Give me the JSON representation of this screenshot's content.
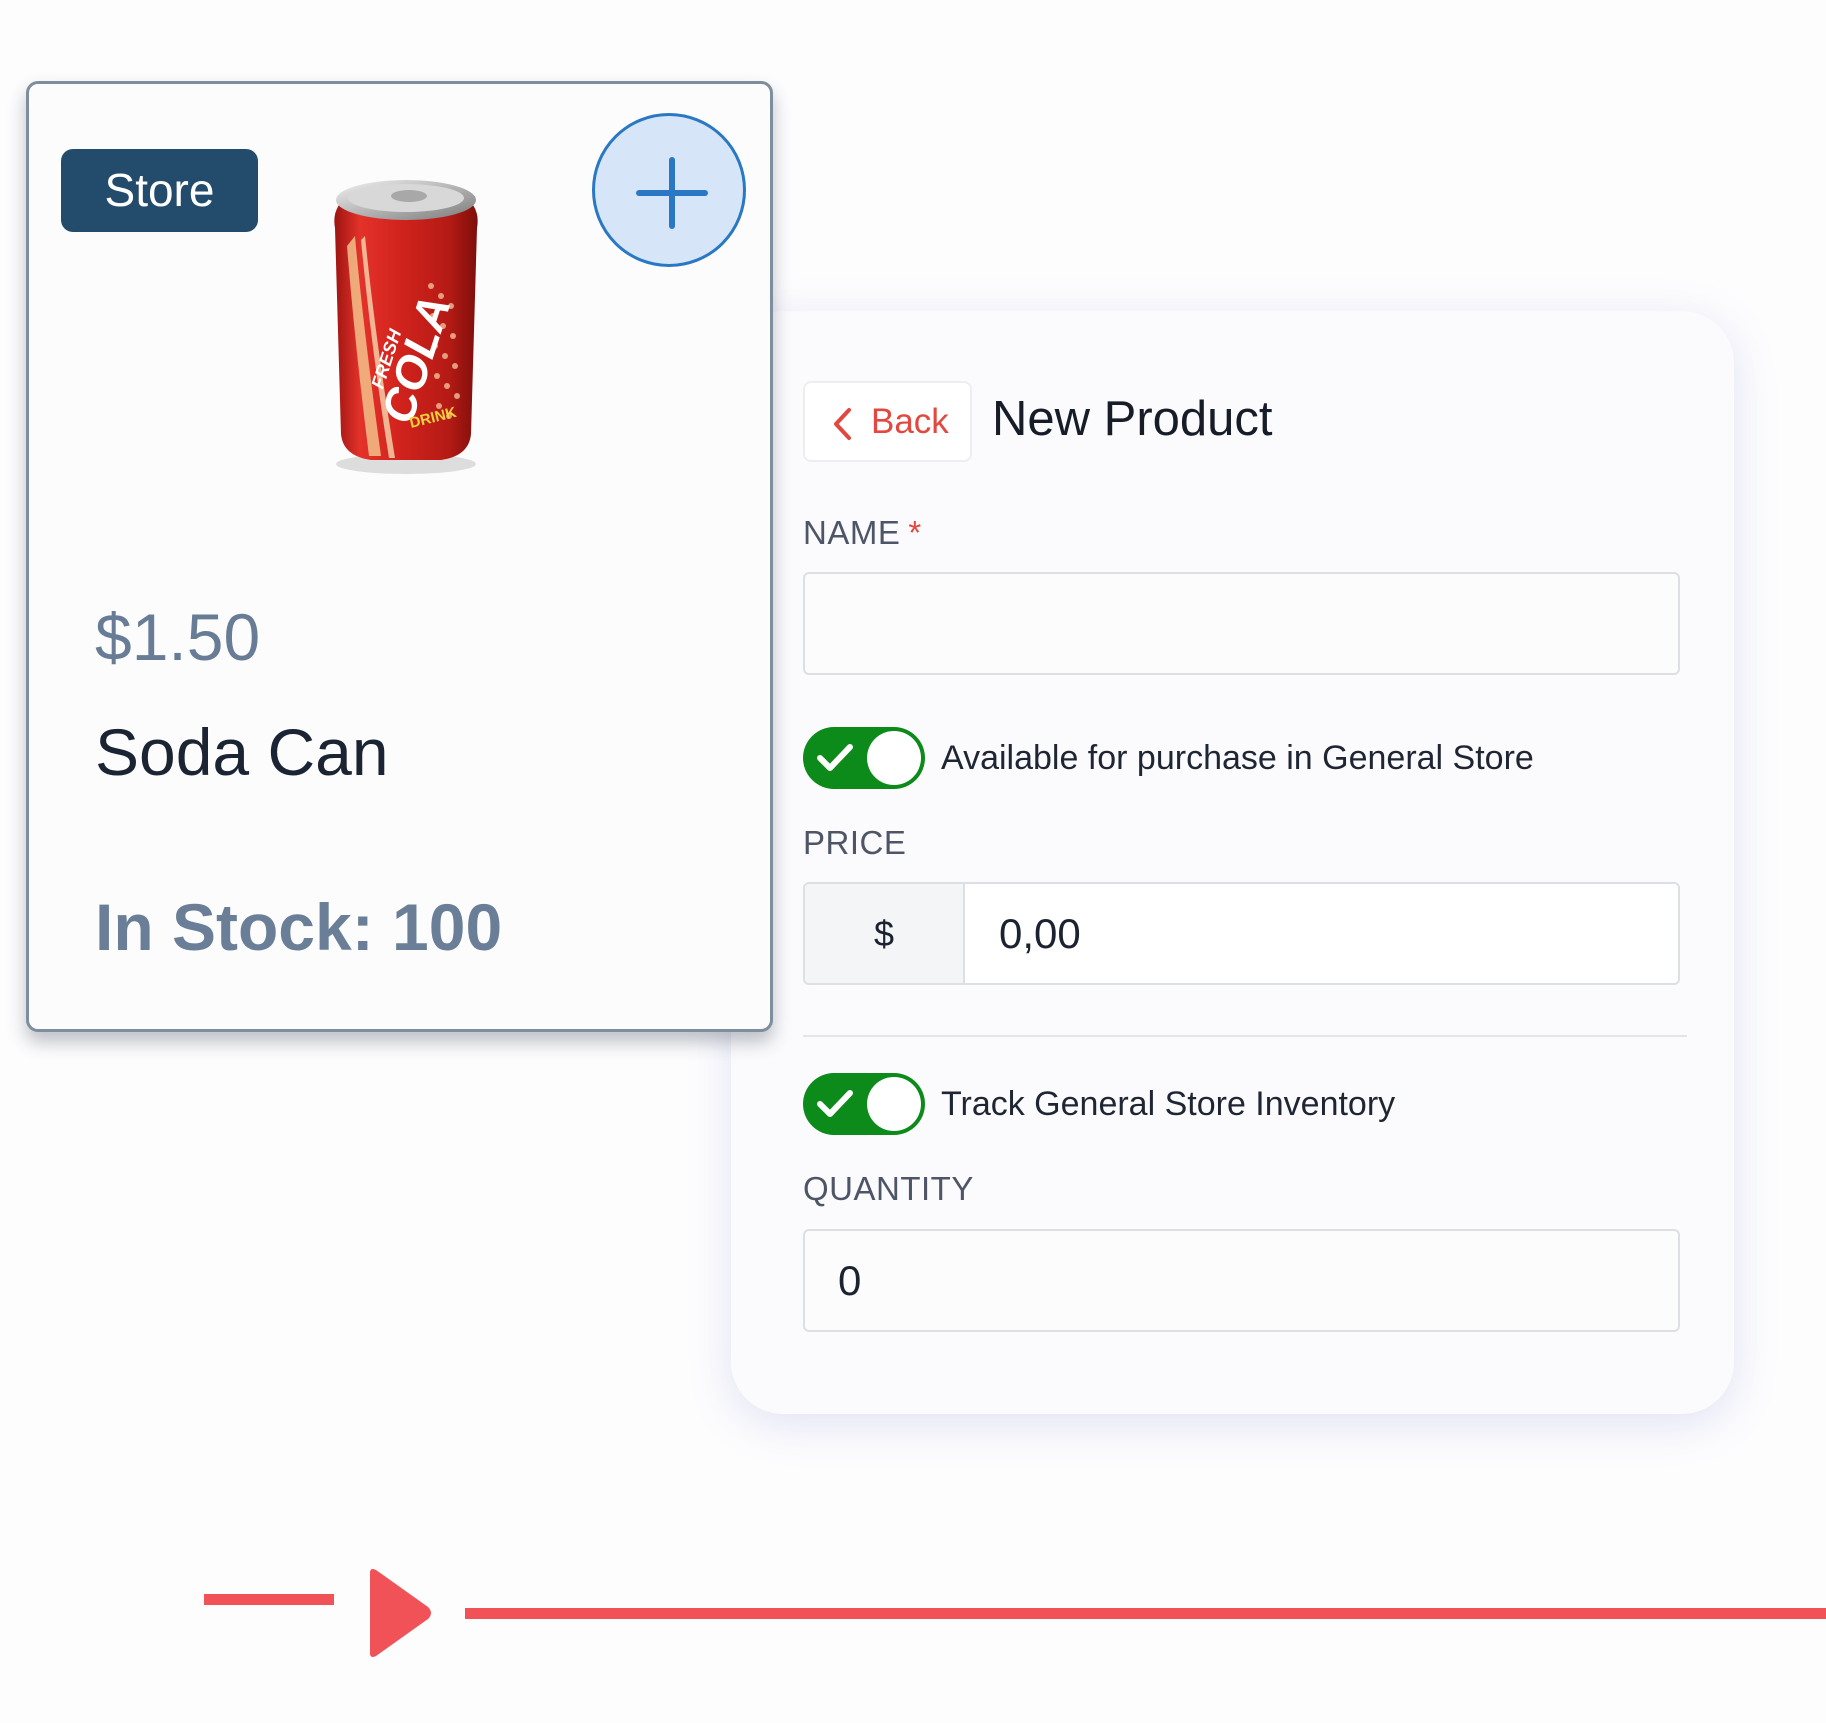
{
  "product_card": {
    "badge": "Store",
    "add_button_icon": "plus-icon",
    "image_icon": "soda-can-image",
    "price": "$1.50",
    "name": "Soda Can",
    "stock": "In Stock: 100"
  },
  "new_product_form": {
    "back_label": "Back",
    "title": "New Product",
    "name_label": "NAME",
    "name_required_marker": "*",
    "name_value": "",
    "available_toggle": {
      "label": "Available for purchase in General Store",
      "on": true
    },
    "price_label": "PRICE",
    "price_currency": "$",
    "price_value": "0,00",
    "track_toggle": {
      "label": "Track General Store Inventory",
      "on": true
    },
    "quantity_label": "QUANTITY",
    "quantity_value": "0"
  },
  "colors": {
    "badge_bg": "#234b6c",
    "accent_blue": "#2a78c4",
    "toggle_on": "#0c8a1a",
    "accent_red": "#e2483f",
    "arrow_red": "#f05258"
  }
}
